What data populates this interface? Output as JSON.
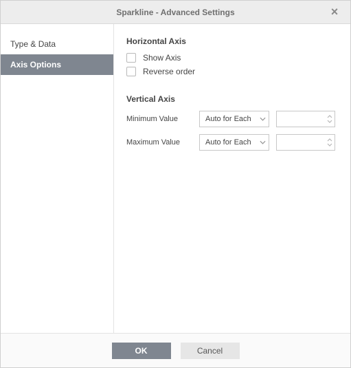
{
  "dialog": {
    "title": "Sparkline - Advanced Settings"
  },
  "sidebar": {
    "items": [
      {
        "label": "Type & Data"
      },
      {
        "label": "Axis Options"
      }
    ],
    "active_index": 1
  },
  "content": {
    "horizontal_axis": {
      "title": "Horizontal Axis",
      "show_axis": {
        "label": "Show Axis",
        "checked": false
      },
      "reverse_order": {
        "label": "Reverse order",
        "checked": false
      }
    },
    "vertical_axis": {
      "title": "Vertical Axis",
      "min": {
        "label": "Minimum Value",
        "mode": "Auto for Each",
        "value": ""
      },
      "max": {
        "label": "Maximum Value",
        "mode": "Auto for Each",
        "value": ""
      }
    }
  },
  "footer": {
    "ok": "OK",
    "cancel": "Cancel"
  }
}
